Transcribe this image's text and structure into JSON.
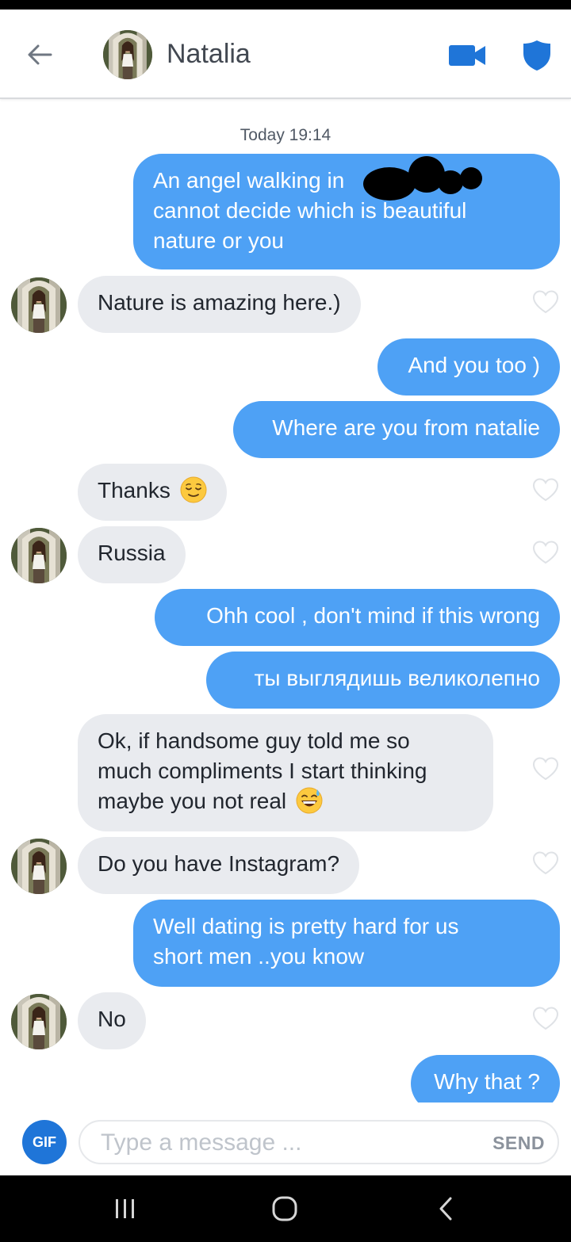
{
  "header": {
    "contact_name": "Natalia",
    "back_icon": "arrow-left-icon",
    "video_icon": "video-camera-icon",
    "safety_icon": "shield-icon"
  },
  "chat": {
    "timestamp": "Today 19:14",
    "messages": [
      {
        "id": "m1",
        "direction": "outgoing",
        "lines": [
          "An angel walking in",
          "cannot decide which is beautiful",
          "nature or you"
        ],
        "redacted": true
      },
      {
        "id": "m2",
        "direction": "incoming",
        "text": "Nature is amazing here.)"
      },
      {
        "id": "m3",
        "direction": "outgoing",
        "text": "And you too )"
      },
      {
        "id": "m4",
        "direction": "outgoing",
        "text": "Where are you from natalie"
      },
      {
        "id": "m5",
        "direction": "incoming",
        "text": "Thanks",
        "emoji": "relieved-face"
      },
      {
        "id": "m6",
        "direction": "incoming",
        "text": "Russia"
      },
      {
        "id": "m7",
        "direction": "outgoing",
        "text": "Ohh cool , don't mind if this wrong"
      },
      {
        "id": "m8",
        "direction": "outgoing",
        "text": "ты выглядишь великолепно"
      },
      {
        "id": "m9",
        "direction": "incoming",
        "lines": [
          "Ok, if handsome guy told me so",
          "much compliments I start thinking",
          "maybe you not real"
        ],
        "emoji": "grinning-sweat-face"
      },
      {
        "id": "m10",
        "direction": "incoming",
        "text": "Do you have Instagram?"
      },
      {
        "id": "m11",
        "direction": "outgoing",
        "lines": [
          "Well dating is pretty hard for us",
          "short men ..you know"
        ]
      },
      {
        "id": "m12",
        "direction": "incoming",
        "text": "No"
      },
      {
        "id": "m13",
        "direction": "outgoing",
        "text": "Why that ?"
      }
    ]
  },
  "composer": {
    "gif_label": "GIF",
    "placeholder": "Type a message ...",
    "send_label": "SEND"
  },
  "navigation": {
    "recents_icon": "recents-icon",
    "home_icon": "home-icon",
    "back_icon": "back-chevron-icon"
  },
  "colors": {
    "outgoing_bubble": "#4ea1f5",
    "incoming_bubble": "#e9ebef",
    "accent": "#1f75d8",
    "header_icon": "#1f75d8"
  }
}
